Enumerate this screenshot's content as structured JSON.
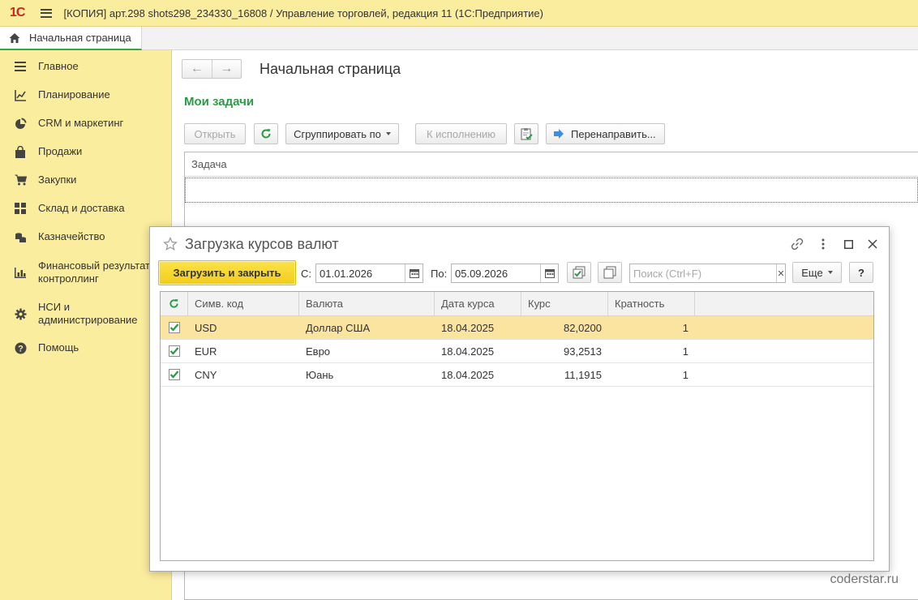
{
  "app": {
    "logo": "1С",
    "window_title": "[КОПИЯ] арт.298 shots298_234330_16808 / Управление торговлей, редакция 11  (1С:Предприятие)"
  },
  "tabs": [
    {
      "label": "Начальная страница",
      "icon": "home-icon",
      "active": true
    }
  ],
  "sidebar": {
    "items": [
      {
        "label": "Главное",
        "icon": "menu-lines-icon"
      },
      {
        "label": "Планирование",
        "icon": "planning-chart-icon"
      },
      {
        "label": "CRM и маркетинг",
        "icon": "pie-chart-icon"
      },
      {
        "label": "Продажи",
        "icon": "shopping-bag-icon"
      },
      {
        "label": "Закупки",
        "icon": "cart-icon"
      },
      {
        "label": "Склад и доставка",
        "icon": "warehouse-grid-icon"
      },
      {
        "label": "Казначейство",
        "icon": "coins-icon"
      },
      {
        "label_line1": "Финансовый результат и",
        "label_line2": "контроллинг",
        "icon": "bar-chart-icon"
      },
      {
        "label_line1": "НСИ и",
        "label_line2": "администрирование",
        "icon": "gear-icon"
      },
      {
        "label": "Помощь",
        "icon": "help-icon"
      }
    ]
  },
  "main": {
    "page_title": "Начальная страница",
    "section_title": "Мои задачи",
    "toolbar": {
      "open": "Открыть",
      "group_by": "Сгруппировать по",
      "to_execution": "К исполнению",
      "redirect": "Перенаправить..."
    },
    "table": {
      "column_task": "Задача"
    }
  },
  "dialog": {
    "title": "Загрузка курсов валют",
    "load_close": "Загрузить и закрыть",
    "from_label": "С:",
    "from_value": "01.01.2026",
    "to_label": "По:",
    "to_value": "05.09.2026",
    "search_placeholder": "Поиск (Ctrl+F)",
    "more": "Еще",
    "help": "?",
    "columns": [
      "Симв. код",
      "Валюта",
      "Дата курса",
      "Курс",
      "Кратность"
    ],
    "rows": [
      {
        "checked": true,
        "code": "USD",
        "currency": "Доллар США",
        "date": "18.04.2025",
        "rate": "82,0200",
        "multiplicity": "1",
        "highlighted": true
      },
      {
        "checked": true,
        "code": "EUR",
        "currency": "Евро",
        "date": "18.04.2025",
        "rate": "93,2513",
        "multiplicity": "1",
        "highlighted": false
      },
      {
        "checked": true,
        "code": "CNY",
        "currency": "Юань",
        "date": "18.04.2025",
        "rate": "11,1915",
        "multiplicity": "1",
        "highlighted": false
      }
    ]
  },
  "watermark": "coderstar.ru",
  "colors": {
    "panel_yellow": "#fbed9e",
    "accent_green": "#2a9a44",
    "primary_button": "#f2cc1a",
    "row_highlight": "#fbe3a0"
  }
}
